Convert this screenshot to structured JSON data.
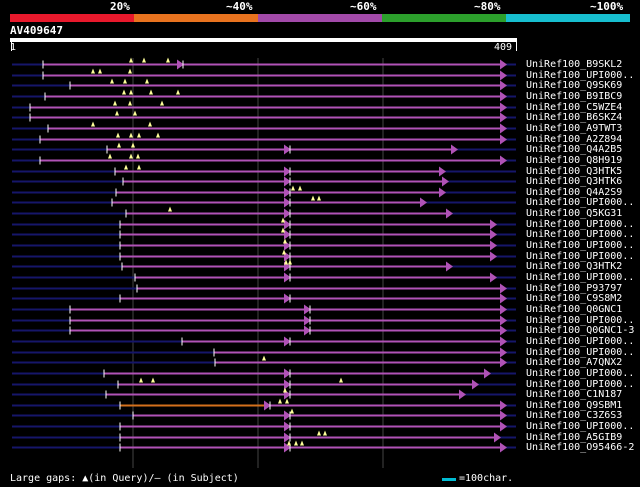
{
  "query": {
    "id": "AV409647",
    "start": "1",
    "end": "409"
  },
  "legend": {
    "segments": [
      {
        "label": "20%",
        "color": "#e8192c"
      },
      {
        "label": "~40%",
        "color": "#e8731f"
      },
      {
        "label": "~60%",
        "color": "#a24aa9"
      },
      {
        "label": "~80%",
        "color": "#2ca02c"
      },
      {
        "label": "~100%",
        "color": "#17becf"
      }
    ]
  },
  "colors": {
    "hit": "#b052b6",
    "orange_hit": "#d4701c",
    "background_line": "#16166a",
    "marker": "#ffff99",
    "axis": "#ffffff"
  },
  "hits": [
    {
      "label": "UniRef100_B9SKL2"
    },
    {
      "label": "UniRef100_UPI000.."
    },
    {
      "label": "UniRef100_Q9SK69"
    },
    {
      "label": "UniRef100_B9IBC9"
    },
    {
      "label": "UniRef100_C5WZE4"
    },
    {
      "label": "UniRef100_B6SKZ4"
    },
    {
      "label": "UniRef100_A9TWT3"
    },
    {
      "label": "UniRef100_A2Z894"
    },
    {
      "label": "UniRef100_Q4A2B5"
    },
    {
      "label": "UniRef100_Q8H919"
    },
    {
      "label": "UniRef100_Q3HTK5"
    },
    {
      "label": "UniRef100_Q3HTK6"
    },
    {
      "label": "UniRef100_Q4A2S9"
    },
    {
      "label": "UniRef100_UPI000.."
    },
    {
      "label": "UniRef100_Q5KG31"
    },
    {
      "label": "UniRef100_UPI000.."
    },
    {
      "label": "UniRef100_UPI000.."
    },
    {
      "label": "UniRef100_UPI000.."
    },
    {
      "label": "UniRef100_UPI000.."
    },
    {
      "label": "UniRef100_Q3HTK2"
    },
    {
      "label": "UniRef100_UPI000.."
    },
    {
      "label": "UniRef100_P93797"
    },
    {
      "label": "UniRef100_C9S8M2"
    },
    {
      "label": "UniRef100_Q0GNC1"
    },
    {
      "label": "UniRef100_UPI000.."
    },
    {
      "label": "UniRef100_Q0GNC1-3"
    },
    {
      "label": "UniRef100_UPI000.."
    },
    {
      "label": "UniRef100_UPI000.."
    },
    {
      "label": "UniRef100_A7QNX2"
    },
    {
      "label": "UniRef100_UPI000.."
    },
    {
      "label": "UniRef100_UPI000.."
    },
    {
      "label": "UniRef100_C1N187"
    },
    {
      "label": "UniRef100_Q9SBM1"
    },
    {
      "label": "UniRef100_C3Z6S3"
    },
    {
      "label": "UniRef100_UPI000.."
    },
    {
      "label": "UniRef100_A5GIB9"
    },
    {
      "label": "UniRef100_O95466-2"
    }
  ],
  "footer": {
    "gaps_text": "Large gaps: ▲(in Query)/– (in Subject)",
    "scale_text": "=100char."
  }
}
